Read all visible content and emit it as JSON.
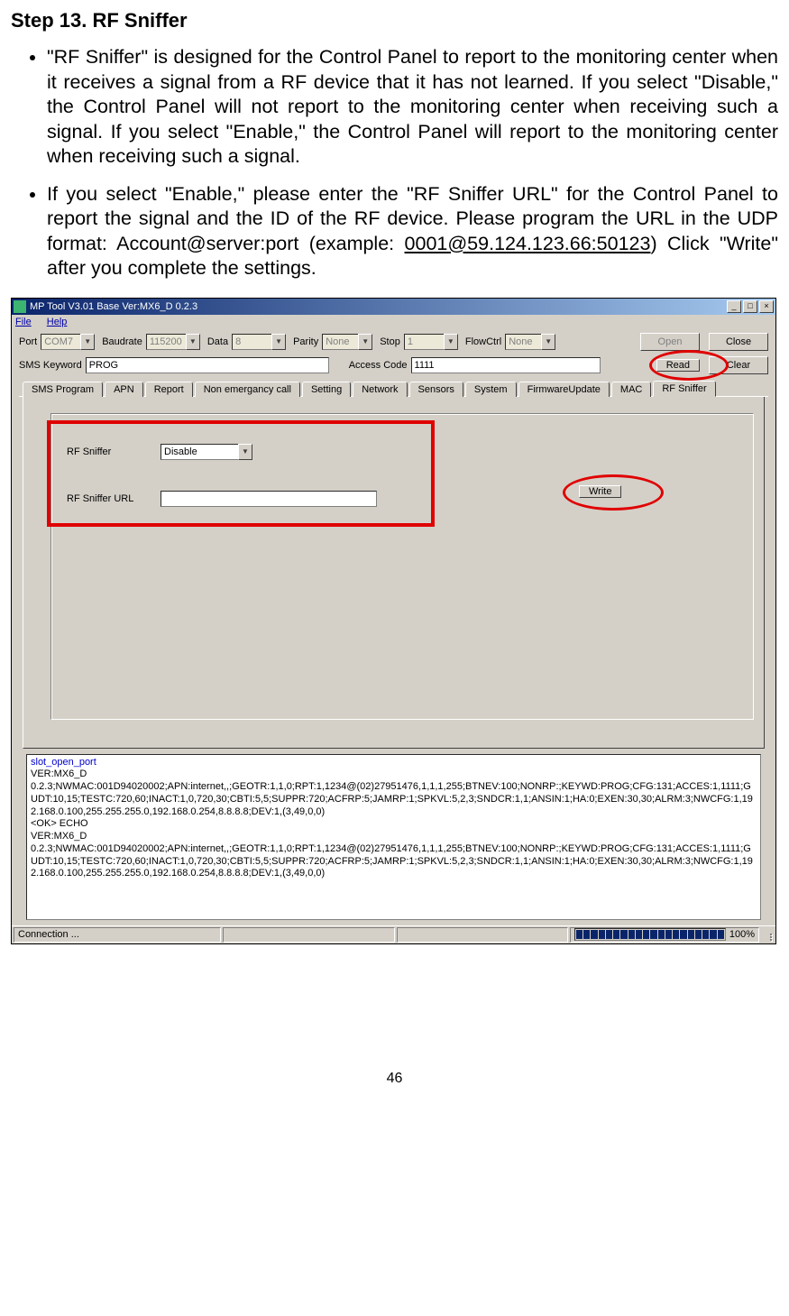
{
  "doc": {
    "step_title": "Step 13. RF Sniffer",
    "bullet1": "\"RF Sniffer\" is designed for the Control Panel to report to the monitoring center when it receives a signal from a RF device that it has not learned. If you select \"Disable,\" the Control Panel will not report to the monitoring center when receiving such a signal. If you select \"Enable,\" the Control Panel will report to the monitoring center when receiving such a signal.",
    "bullet2_pre": "If you select \"Enable,\" please enter the \"RF Sniffer URL\" for the Control Panel to report the signal and the ID of the RF device. Please program the URL in the UDP format: Account@server:port (example: ",
    "bullet2_link": "0001@59.124.123.66:50123",
    "bullet2_post": ") Click \"Write\" after you complete the settings.",
    "page_number": "46"
  },
  "window": {
    "title": "MP Tool V3.01  Base Ver:MX6_D 0.2.3",
    "menu_file": "File",
    "menu_help": "Help"
  },
  "serial": {
    "port_label": "Port",
    "port_value": "COM7",
    "baud_label": "Baudrate",
    "baud_value": "115200",
    "data_label": "Data",
    "data_value": "8",
    "parity_label": "Parity",
    "parity_value": "None",
    "stop_label": "Stop",
    "stop_value": "1",
    "flow_label": "FlowCtrl",
    "flow_value": "None",
    "open_btn": "Open",
    "close_btn": "Close"
  },
  "sms": {
    "keyword_label": "SMS Keyword",
    "keyword_value": "PROG",
    "access_label": "Access Code",
    "access_value": "1111",
    "read_btn": "Read",
    "clear_btn": "Clear"
  },
  "tabs": {
    "t1": "SMS Program",
    "t2": "APN",
    "t3": "Report",
    "t4": "Non emergancy call",
    "t5": "Setting",
    "t6": "Network",
    "t7": "Sensors",
    "t8": "System",
    "t9": "FirmwareUpdate",
    "t10": "MAC",
    "t11": "RF Sniffer"
  },
  "rf": {
    "sniffer_label": "RF Sniffer",
    "sniffer_value": "Disable",
    "url_label": "RF Sniffer URL",
    "url_value": "",
    "write_btn": "Write"
  },
  "log": {
    "l1": "slot_open_port",
    "l2": "",
    "l3": "VER:MX6_D",
    "l4": "0.2.3;NWMAC:001D94020002;APN:internet,,;GEOTR:1,1,0;RPT:1,1234@(02)27951476,1,1,1,255;BTNEV:100;NONRP:;KEYWD:PROG;CFG:131;ACCES:1,1111;GUDT:10,15;TESTC:720,60;INACT:1,0,720,30;CBTI:5,5;SUPPR:720;ACFRP:5;JAMRP:1;SPKVL:5,2,3;SNDCR:1,1;ANSIN:1;HA:0;EXEN:30,30;ALRM:3;NWCFG:1,192.168.0.100,255.255.255.0,192.168.0.254,8.8.8.8;DEV:1,(3,49,0,0)",
    "l5": "<OK> ECHO",
    "l6": "VER:MX6_D",
    "l7": "0.2.3;NWMAC:001D94020002;APN:internet,,;GEOTR:1,1,0;RPT:1,1234@(02)27951476,1,1,1,255;BTNEV:100;NONRP:;KEYWD:PROG;CFG:131;ACCES:1,1111;GUDT:10,15;TESTC:720,60;INACT:1,0,720,30;CBTI:5,5;SUPPR:720;ACFRP:5;JAMRP:1;SPKVL:5,2,3;SNDCR:1,1;ANSIN:1;HA:0;EXEN:30,30;ALRM:3;NWCFG:1,192.168.0.100,255.255.255.0,192.168.0.254,8.8.8.8;DEV:1,(3,49,0,0)"
  },
  "status": {
    "conn": "Connection ...",
    "pct": "100%"
  }
}
